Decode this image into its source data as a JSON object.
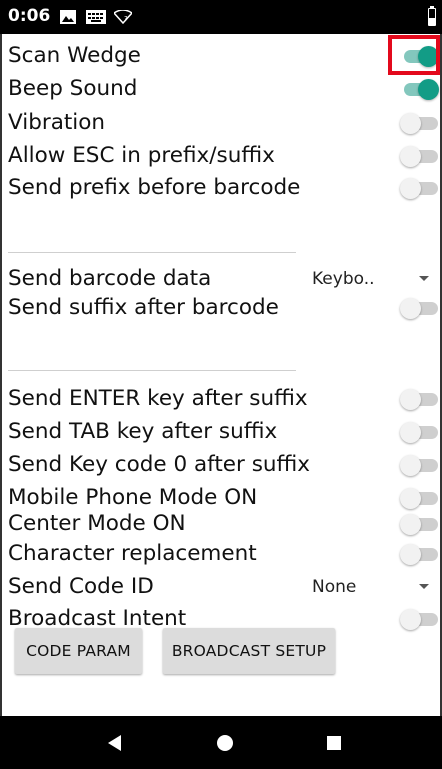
{
  "status_bar": {
    "time": "0:06",
    "icons": [
      "image-icon",
      "keyboard-icon",
      "wifi-icon",
      "battery-icon"
    ]
  },
  "settings": {
    "scan_wedge": {
      "label": "Scan Wedge",
      "on": true
    },
    "beep_sound": {
      "label": "Beep Sound",
      "on": true
    },
    "vibration": {
      "label": "Vibration",
      "on": false
    },
    "allow_esc": {
      "label": "Allow ESC in prefix/suffix",
      "on": false
    },
    "send_prefix": {
      "label": "Send prefix before barcode",
      "on": false
    },
    "send_barcode_data": {
      "label": "Send barcode data",
      "value": "Keybo.."
    },
    "send_suffix": {
      "label": "Send suffix after barcode",
      "on": false
    },
    "send_enter": {
      "label": "Send ENTER key after suffix",
      "on": false
    },
    "send_tab": {
      "label": "Send TAB key after suffix",
      "on": false
    },
    "send_keycode0": {
      "label": "Send Key code 0 after suffix",
      "on": false
    },
    "mobile_phone_mode": {
      "label": "Mobile Phone Mode ON",
      "on": false
    },
    "center_mode": {
      "label": "Center Mode ON",
      "on": false
    },
    "char_replacement": {
      "label": "Character replacement",
      "on": false
    },
    "send_code_id": {
      "label": "Send Code ID",
      "value": "None"
    },
    "broadcast_intent": {
      "label": "Broadcast  Intent",
      "on": false
    }
  },
  "buttons": {
    "code_param": "CODE PARAM",
    "broadcast_setup": "BROADCAST SETUP"
  },
  "colors": {
    "switch_on_thumb": "#129c86",
    "switch_on_track": "#83c7bd",
    "switch_off_track": "#cfcfcf",
    "highlight": "#e3091c"
  },
  "nav_bar": {
    "icons": [
      "back-icon",
      "home-icon",
      "recent-apps-icon"
    ]
  }
}
